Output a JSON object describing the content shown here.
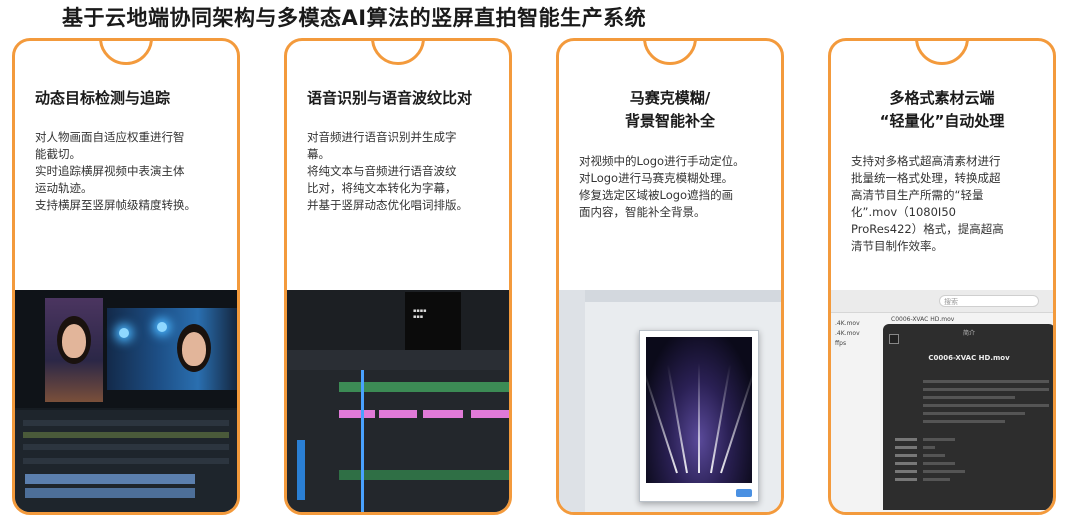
{
  "page": {
    "title": "基于云地端协同架构与多模态AI算法的竖屏直拍智能生产系统"
  },
  "cards": [
    {
      "title_lines": [
        "动态目标检测与追踪"
      ],
      "desc_lines": [
        "对人物画面自适应权重进行智",
        "能截切。",
        "实时追踪横屏视频中表演主体",
        "运动轨迹。",
        "支持横屏至竖屏帧级精度转换。"
      ]
    },
    {
      "title_lines": [
        "语音识别与语音波纹比对"
      ],
      "desc_lines": [
        "对音频进行语音识别并生成字",
        "幕。",
        "将纯文本与音频进行语音波纹",
        "比对，将纯文本转化为字幕，",
        "并基于竖屏动态优化唱词排版。"
      ]
    },
    {
      "title_lines": [
        "马赛克模糊/",
        "背景智能补全"
      ],
      "desc_lines": [
        "对视频中的Logo进行手动定位。",
        "对Logo进行马赛克模糊处理。",
        "修复选定区域被Logo遮挡的画",
        "面内容，智能补全背景。"
      ]
    },
    {
      "title_lines": [
        "多格式素材云端",
        "“轻量化”自动处理"
      ],
      "desc_lines": [
        "支持对多格式超高清素材进行",
        "批量统一格式处理，转换成超",
        "高清节目生产所需的“轻量",
        "化”.mov（1080I50",
        "ProRes422）格式，提高超高",
        "清节目制作效率。"
      ]
    }
  ],
  "screenshot4": {
    "search_placeholder": "搜索",
    "file_item": "C0006-XVAC HD.mov",
    "info_title": "简介",
    "info_name": "C0006-XVAC HD.mov",
    "side_items": [
      ".4K.mov",
      ".4K.mov",
      "ffps"
    ]
  },
  "colors": {
    "card_border": "#f39a3c",
    "text": "#1a1a1a"
  }
}
